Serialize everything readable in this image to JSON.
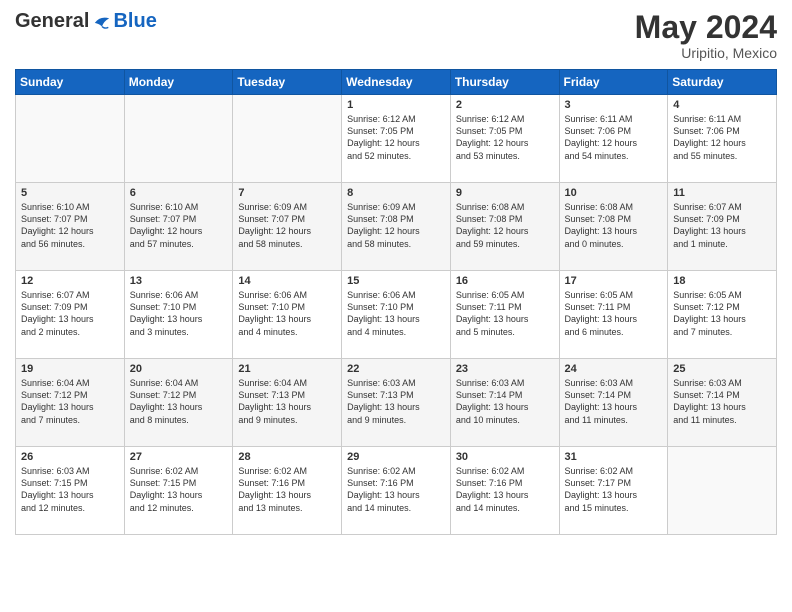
{
  "logo": {
    "general": "General",
    "blue": "Blue"
  },
  "title": {
    "month_year": "May 2024",
    "location": "Uripitio, Mexico"
  },
  "days_header": [
    "Sunday",
    "Monday",
    "Tuesday",
    "Wednesday",
    "Thursday",
    "Friday",
    "Saturday"
  ],
  "weeks": [
    [
      {
        "day": "",
        "info": ""
      },
      {
        "day": "",
        "info": ""
      },
      {
        "day": "",
        "info": ""
      },
      {
        "day": "1",
        "info": "Sunrise: 6:12 AM\nSunset: 7:05 PM\nDaylight: 12 hours\nand 52 minutes."
      },
      {
        "day": "2",
        "info": "Sunrise: 6:12 AM\nSunset: 7:05 PM\nDaylight: 12 hours\nand 53 minutes."
      },
      {
        "day": "3",
        "info": "Sunrise: 6:11 AM\nSunset: 7:06 PM\nDaylight: 12 hours\nand 54 minutes."
      },
      {
        "day": "4",
        "info": "Sunrise: 6:11 AM\nSunset: 7:06 PM\nDaylight: 12 hours\nand 55 minutes."
      }
    ],
    [
      {
        "day": "5",
        "info": "Sunrise: 6:10 AM\nSunset: 7:07 PM\nDaylight: 12 hours\nand 56 minutes."
      },
      {
        "day": "6",
        "info": "Sunrise: 6:10 AM\nSunset: 7:07 PM\nDaylight: 12 hours\nand 57 minutes."
      },
      {
        "day": "7",
        "info": "Sunrise: 6:09 AM\nSunset: 7:07 PM\nDaylight: 12 hours\nand 58 minutes."
      },
      {
        "day": "8",
        "info": "Sunrise: 6:09 AM\nSunset: 7:08 PM\nDaylight: 12 hours\nand 58 minutes."
      },
      {
        "day": "9",
        "info": "Sunrise: 6:08 AM\nSunset: 7:08 PM\nDaylight: 12 hours\nand 59 minutes."
      },
      {
        "day": "10",
        "info": "Sunrise: 6:08 AM\nSunset: 7:08 PM\nDaylight: 13 hours\nand 0 minutes."
      },
      {
        "day": "11",
        "info": "Sunrise: 6:07 AM\nSunset: 7:09 PM\nDaylight: 13 hours\nand 1 minute."
      }
    ],
    [
      {
        "day": "12",
        "info": "Sunrise: 6:07 AM\nSunset: 7:09 PM\nDaylight: 13 hours\nand 2 minutes."
      },
      {
        "day": "13",
        "info": "Sunrise: 6:06 AM\nSunset: 7:10 PM\nDaylight: 13 hours\nand 3 minutes."
      },
      {
        "day": "14",
        "info": "Sunrise: 6:06 AM\nSunset: 7:10 PM\nDaylight: 13 hours\nand 4 minutes."
      },
      {
        "day": "15",
        "info": "Sunrise: 6:06 AM\nSunset: 7:10 PM\nDaylight: 13 hours\nand 4 minutes."
      },
      {
        "day": "16",
        "info": "Sunrise: 6:05 AM\nSunset: 7:11 PM\nDaylight: 13 hours\nand 5 minutes."
      },
      {
        "day": "17",
        "info": "Sunrise: 6:05 AM\nSunset: 7:11 PM\nDaylight: 13 hours\nand 6 minutes."
      },
      {
        "day": "18",
        "info": "Sunrise: 6:05 AM\nSunset: 7:12 PM\nDaylight: 13 hours\nand 7 minutes."
      }
    ],
    [
      {
        "day": "19",
        "info": "Sunrise: 6:04 AM\nSunset: 7:12 PM\nDaylight: 13 hours\nand 7 minutes."
      },
      {
        "day": "20",
        "info": "Sunrise: 6:04 AM\nSunset: 7:12 PM\nDaylight: 13 hours\nand 8 minutes."
      },
      {
        "day": "21",
        "info": "Sunrise: 6:04 AM\nSunset: 7:13 PM\nDaylight: 13 hours\nand 9 minutes."
      },
      {
        "day": "22",
        "info": "Sunrise: 6:03 AM\nSunset: 7:13 PM\nDaylight: 13 hours\nand 9 minutes."
      },
      {
        "day": "23",
        "info": "Sunrise: 6:03 AM\nSunset: 7:14 PM\nDaylight: 13 hours\nand 10 minutes."
      },
      {
        "day": "24",
        "info": "Sunrise: 6:03 AM\nSunset: 7:14 PM\nDaylight: 13 hours\nand 11 minutes."
      },
      {
        "day": "25",
        "info": "Sunrise: 6:03 AM\nSunset: 7:14 PM\nDaylight: 13 hours\nand 11 minutes."
      }
    ],
    [
      {
        "day": "26",
        "info": "Sunrise: 6:03 AM\nSunset: 7:15 PM\nDaylight: 13 hours\nand 12 minutes."
      },
      {
        "day": "27",
        "info": "Sunrise: 6:02 AM\nSunset: 7:15 PM\nDaylight: 13 hours\nand 12 minutes."
      },
      {
        "day": "28",
        "info": "Sunrise: 6:02 AM\nSunset: 7:16 PM\nDaylight: 13 hours\nand 13 minutes."
      },
      {
        "day": "29",
        "info": "Sunrise: 6:02 AM\nSunset: 7:16 PM\nDaylight: 13 hours\nand 14 minutes."
      },
      {
        "day": "30",
        "info": "Sunrise: 6:02 AM\nSunset: 7:16 PM\nDaylight: 13 hours\nand 14 minutes."
      },
      {
        "day": "31",
        "info": "Sunrise: 6:02 AM\nSunset: 7:17 PM\nDaylight: 13 hours\nand 15 minutes."
      },
      {
        "day": "",
        "info": ""
      }
    ]
  ]
}
